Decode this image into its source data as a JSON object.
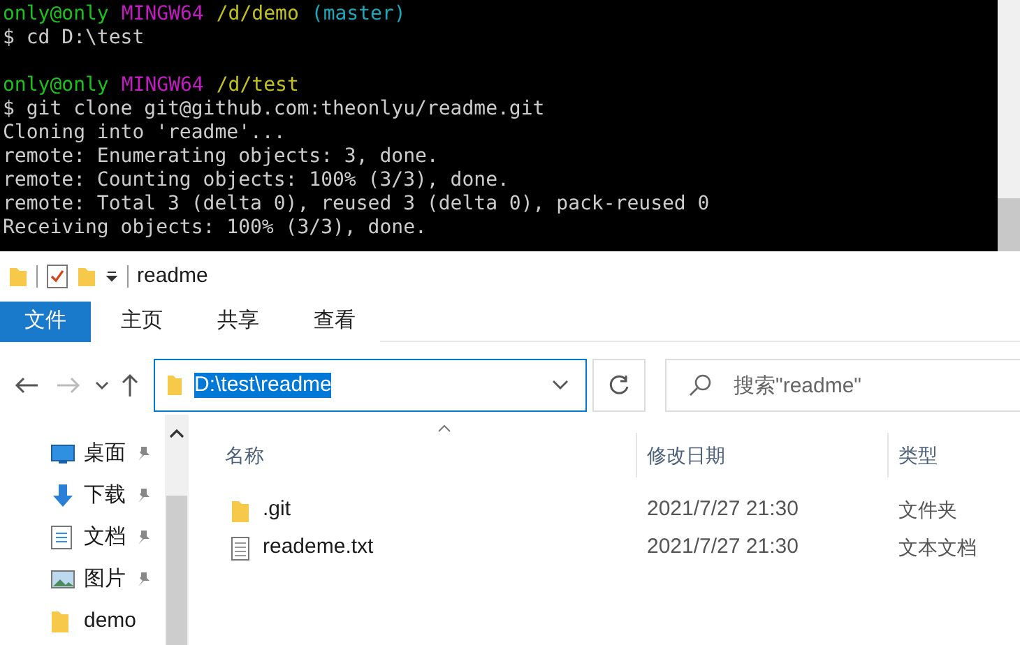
{
  "terminal": {
    "blocks": [
      {
        "lines": [
          {
            "segments": [
              {
                "text": "only@only",
                "color": "#1cc21c"
              },
              {
                "text": "MINGW64",
                "color": "#c21cc2"
              },
              {
                "text": "/d/demo",
                "color": "#c2c21c"
              },
              {
                "text": "(master)",
                "color": "#1ca8b8"
              }
            ]
          },
          {
            "segments": [
              {
                "text": "$ cd D:\\test",
                "color": "#cccccc"
              }
            ]
          }
        ]
      },
      {
        "lines": [
          {
            "segments": [
              {
                "text": "only@only",
                "color": "#1cc21c"
              },
              {
                "text": "MINGW64",
                "color": "#c21cc2"
              },
              {
                "text": "/d/test",
                "color": "#c2c21c"
              }
            ]
          },
          {
            "segments": [
              {
                "text": "$ git clone git@github.com:theonlyu/readme.git",
                "color": "#cccccc"
              }
            ]
          },
          {
            "segments": [
              {
                "text": "Cloning into 'readme'...",
                "color": "#cccccc"
              }
            ]
          },
          {
            "segments": [
              {
                "text": "remote: Enumerating objects: 3, done.",
                "color": "#cccccc"
              }
            ]
          },
          {
            "segments": [
              {
                "text": "remote: Counting objects: 100% (3/3), done.",
                "color": "#cccccc"
              }
            ]
          },
          {
            "segments": [
              {
                "text": "remote: Total 3 (delta 0), reused 3 (delta 0), pack-reused 0",
                "color": "#cccccc"
              }
            ]
          },
          {
            "segments": [
              {
                "text": "Receiving objects: 100% (3/3), done.",
                "color": "#cccccc"
              }
            ]
          }
        ]
      }
    ]
  },
  "explorer": {
    "title": "readme",
    "ribbon_tabs": [
      {
        "label": "文件",
        "selected": true
      },
      {
        "label": "主页",
        "selected": false
      },
      {
        "label": "共享",
        "selected": false
      },
      {
        "label": "查看",
        "selected": false
      }
    ],
    "address": "D:\\test\\readme",
    "search": {
      "placeholder": "搜索\"readme\""
    },
    "sidebar": [
      {
        "label": "桌面",
        "kind": "desktop",
        "pinned": true
      },
      {
        "label": "下载",
        "kind": "download",
        "pinned": true
      },
      {
        "label": "文档",
        "kind": "document",
        "pinned": true
      },
      {
        "label": "图片",
        "kind": "picture",
        "pinned": true
      },
      {
        "label": "demo",
        "kind": "folder",
        "pinned": false
      }
    ],
    "columns": [
      "名称",
      "修改日期",
      "类型"
    ],
    "files": [
      {
        "kind": "folder",
        "name": ".git",
        "date": "2021/7/27 21:30",
        "type": "文件夹"
      },
      {
        "kind": "text",
        "name": "reademe.txt",
        "date": "2021/7/27 21:30",
        "type": "文本文档"
      }
    ]
  }
}
